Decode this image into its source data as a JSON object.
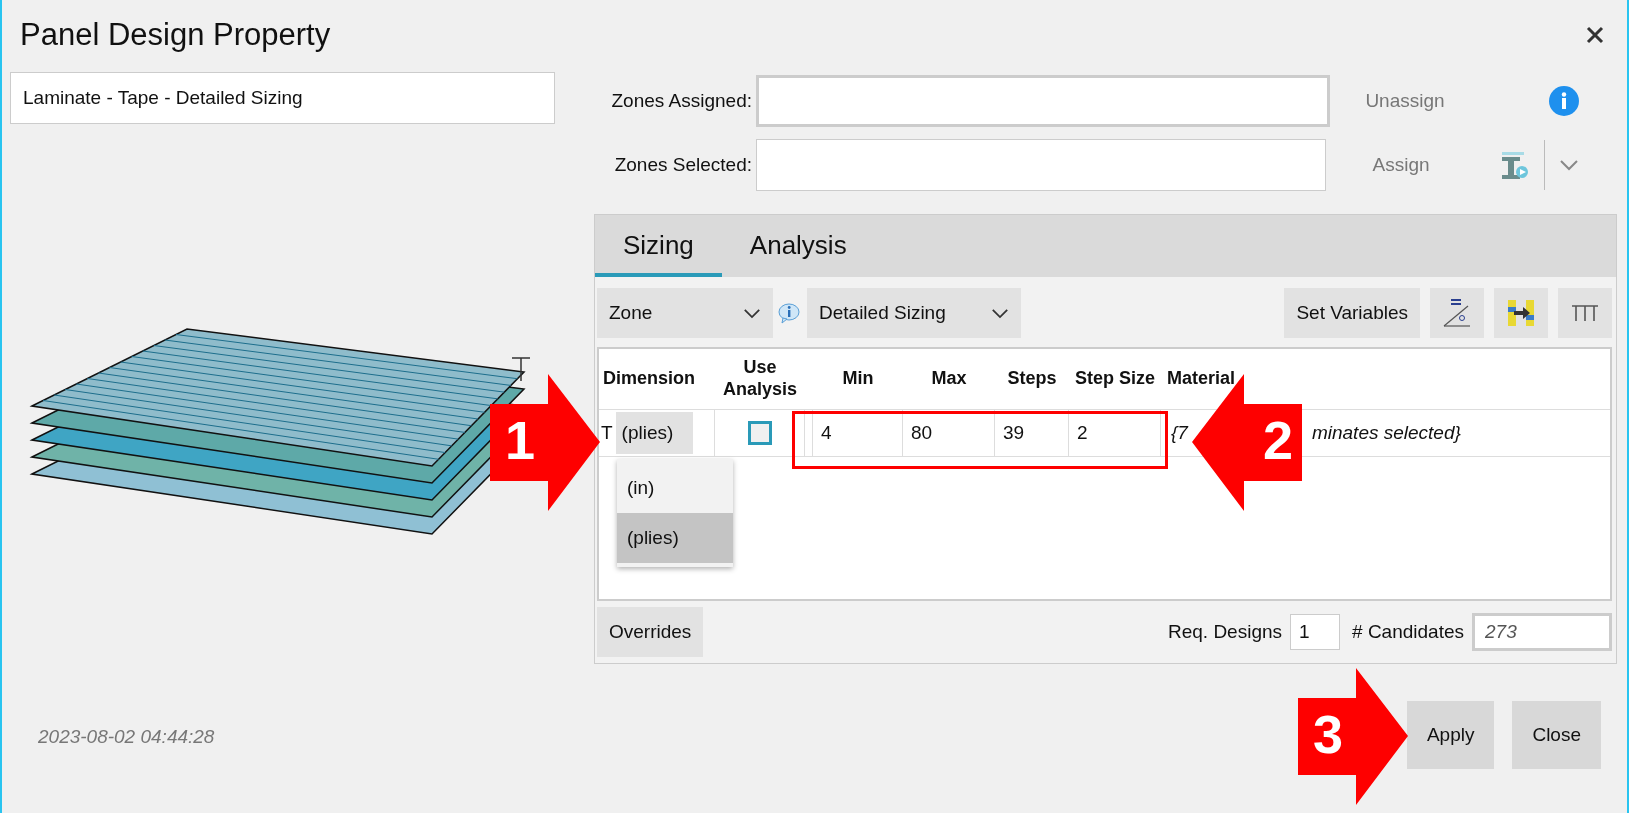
{
  "window": {
    "title": "Panel Design Property"
  },
  "design_name": "Laminate - Tape - Detailed Sizing",
  "zones": [
    {
      "label": "Zones Assigned:",
      "action": "Unassign",
      "disabled": true,
      "kind": "info"
    },
    {
      "label": "Zones Selected:",
      "action": "Assign",
      "disabled": true,
      "kind": "beam"
    }
  ],
  "tabs": [
    {
      "label": "Sizing",
      "selected": true
    },
    {
      "label": "Analysis",
      "selected": false
    }
  ],
  "toolbar": {
    "scope": "Zone",
    "method": "Detailed Sizing",
    "set_variables": "Set Variables"
  },
  "table": {
    "columns": [
      "Dimension",
      "Use Analysis",
      "Min",
      "Max",
      "Steps",
      "Step Size",
      "Material"
    ],
    "rows": [
      {
        "dimension": "T",
        "unit": "(plies)",
        "use_analysis": false,
        "min": "4",
        "max": "80",
        "steps": "39",
        "step_size": "2",
        "material": [
          "{7",
          "minates selected}"
        ]
      }
    ]
  },
  "unit_options": [
    {
      "label": "(in)",
      "selected": false
    },
    {
      "label": "(plies)",
      "selected": true
    }
  ],
  "footer": {
    "overrides": "Overrides",
    "req_designs_label": "Req. Designs",
    "req_designs": "1",
    "candidates_label": "# Candidates",
    "candidates": "273"
  },
  "timestamp": "2023-08-02 04:44:28",
  "buttons": [
    "Apply",
    "Close"
  ],
  "callouts": [
    {
      "number": "1"
    },
    {
      "number": "2"
    },
    {
      "number": "3"
    }
  ]
}
